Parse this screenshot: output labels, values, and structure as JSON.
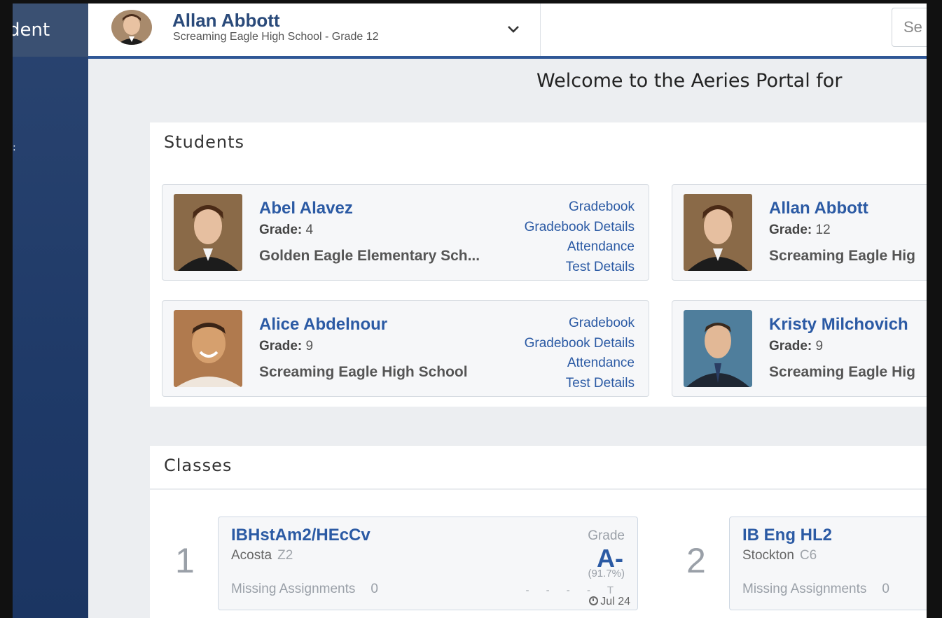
{
  "sidebar": {
    "title": "dent"
  },
  "header": {
    "student_name": "Allan Abbott",
    "student_school": "Screaming Eagle High School - Grade 12",
    "search_placeholder": "Se"
  },
  "welcome": "Welcome to the Aeries Portal for",
  "students_panel": {
    "title": "Students",
    "grade_label": "Grade:",
    "students": [
      {
        "name": "Abel Alavez",
        "grade": "4",
        "school": "Golden Eagle Elementary Sch...",
        "links": [
          "Gradebook",
          "Gradebook Details",
          "Attendance",
          "Test Details"
        ]
      },
      {
        "name": "Allan Abbott",
        "grade": "12",
        "school": "Screaming Eagle Hig"
      },
      {
        "name": "Alice Abdelnour",
        "grade": "9",
        "school": "Screaming Eagle High School",
        "links": [
          "Gradebook",
          "Gradebook Details",
          "Attendance",
          "Test Details"
        ]
      },
      {
        "name": "Kristy Milchovich",
        "grade": "9",
        "school": "Screaming Eagle Hig"
      }
    ]
  },
  "classes_panel": {
    "title": "Classes",
    "classes": [
      {
        "period": "1",
        "name": "IBHstAm2/HEcCv",
        "teacher": "Acosta",
        "room": "Z2",
        "grade_label": "Grade",
        "grade": "A-",
        "percent": "(91.7%)",
        "missing_label": "Missing Assignments",
        "missing": "0",
        "marks": "- - - - T",
        "updated": "Jul 24"
      },
      {
        "period": "2",
        "name": "IB Eng HL2",
        "teacher": "Stockton",
        "room": "C6",
        "missing_label": "Missing Assignments",
        "missing": "0"
      }
    ]
  },
  "colors": {
    "accent": "#2b5aa4",
    "sidebar": "#1f3a68",
    "header_rule": "#2f5796"
  }
}
